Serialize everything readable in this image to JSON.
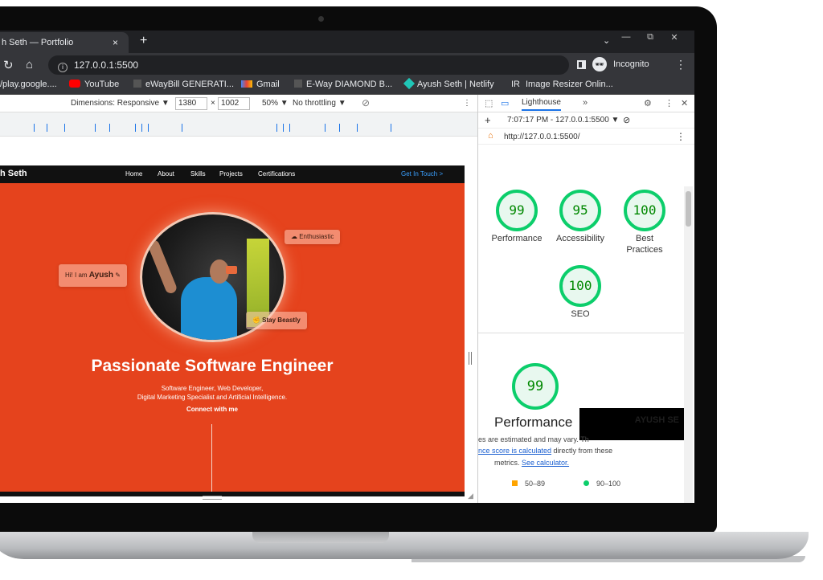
{
  "browser": {
    "tab_title": "h Seth — Portfolio",
    "tab_close": "×",
    "new_tab": "+",
    "tab_list": "⌄",
    "window_controls": [
      "—",
      "⧉",
      "✕"
    ],
    "url": "127.0.0.1:5500",
    "bookmark_star": "☆",
    "incognito_label": "Incognito",
    "menu": "⋮",
    "bookmarks": [
      {
        "label": "/play.google....",
        "icon": "page-icon"
      },
      {
        "label": "YouTube",
        "icon": "youtube-icon",
        "color": "#ff0000"
      },
      {
        "label": "eWayBill GENERATI...",
        "icon": "page-icon"
      },
      {
        "label": "Gmail",
        "icon": "gmail-icon",
        "color": "#ea4335"
      },
      {
        "label": "E-Way DIAMOND B...",
        "icon": "page-icon"
      },
      {
        "label": "Ayush Seth | Netlify",
        "icon": "netlify-icon",
        "color": "#20c6b7"
      },
      {
        "label": "Image Resizer Onlin...",
        "icon": "ir-icon"
      }
    ],
    "ir_prefix": "IR"
  },
  "device_toolbar": {
    "dimensions_label": "Dimensions: Responsive ▼",
    "width": "1380",
    "times": "×",
    "height": "1002",
    "zoom": "50% ▼",
    "throttling": "No throttling ▼",
    "menu": "⋮"
  },
  "site": {
    "brand": "h Seth",
    "nav": [
      "Home",
      "About",
      "Skills",
      "Projects",
      "Certifications"
    ],
    "cta": "Get In Touch >",
    "chips": {
      "enthusiastic": "☁ Enthusiastic",
      "greeting_prefix": "Hi! I am ",
      "greeting_name": "Ayush",
      "greeting_emoji": "✎",
      "beastly": "✊ Stay Beastly"
    },
    "title": "Passionate Software Engineer",
    "subtitle_line1": "Software Engineer, Web Developer,",
    "subtitle_line2": "Digital Marketing Specialist and Artificial Intelligence.",
    "connect": "Connect with me"
  },
  "devtools": {
    "panel_tab": "Lighthouse",
    "more_tabs": "»",
    "run_label": "7:07:17 PM - 127.0.0.1:5500 ▼",
    "audited_url": "http://127.0.0.1:5500/",
    "scores": [
      {
        "label": "Performance",
        "value": "99"
      },
      {
        "label": "Accessibility",
        "value": "95"
      },
      {
        "label": "Best Practices",
        "value": "100"
      },
      {
        "label": "SEO",
        "value": "100"
      }
    ],
    "performance_detail": {
      "value": "99",
      "title": "Performance",
      "redacted_text": "AYUSH SE",
      "note_line1": "es are estimated and may vary. Th",
      "note_line2_link": "nce score is calculated",
      "note_line2_rest": " directly from these",
      "note_line3_prefix": "metrics. ",
      "note_line3_link": "See calculator.",
      "legend": [
        {
          "range": "50–89",
          "color": "#ffa400"
        },
        {
          "range": "90–100",
          "color": "#0cce6b"
        }
      ]
    }
  }
}
